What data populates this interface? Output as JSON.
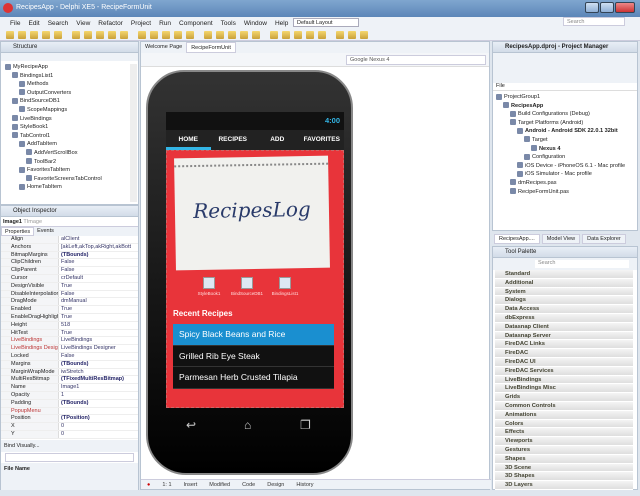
{
  "window": {
    "title": "RecipesApp - Delphi XE5 - RecipeFormUnit"
  },
  "menu": [
    "File",
    "Edit",
    "Search",
    "View",
    "Refactor",
    "Project",
    "Run",
    "Component",
    "Tools",
    "Window",
    "Help"
  ],
  "layout_combo": "Default Layout",
  "search_placeholder": "Search",
  "structure": {
    "title": "Structure",
    "items": [
      {
        "label": "MyRecipeApp",
        "level": 0
      },
      {
        "label": "BindingsList1",
        "level": 1
      },
      {
        "label": "Methods",
        "level": 2
      },
      {
        "label": "OutputConverters",
        "level": 2
      },
      {
        "label": "BindSourceDB1",
        "level": 1
      },
      {
        "label": "ScopeMappings",
        "level": 2
      },
      {
        "label": "LiveBindings",
        "level": 1
      },
      {
        "label": "StyleBook1",
        "level": 1
      },
      {
        "label": "TabControl1",
        "level": 1
      },
      {
        "label": "AddTabItem",
        "level": 2
      },
      {
        "label": "AddVertScrollBox",
        "level": 3
      },
      {
        "label": "ToolBar2",
        "level": 3
      },
      {
        "label": "FavoritesTabItem",
        "level": 2
      },
      {
        "label": "FavoriteScreensTabControl",
        "level": 3
      },
      {
        "label": "HomeTabItem",
        "level": 2
      }
    ]
  },
  "object_inspector": {
    "title": "Object Inspector",
    "selected": "Image1",
    "selected_type": "TImage",
    "tabs": [
      "Properties",
      "Events"
    ],
    "rows": [
      [
        "Align",
        "alClient"
      ],
      [
        "Anchors",
        "[akLeft,akTop,akRight,akBott"
      ],
      [
        "BitmapMargins",
        "(TBounds)"
      ],
      [
        "ClipChildren",
        "False"
      ],
      [
        "ClipParent",
        "False"
      ],
      [
        "Cursor",
        "crDefault"
      ],
      [
        "DesignVisible",
        "True"
      ],
      [
        "DisableInterpolation",
        "False"
      ],
      [
        "DragMode",
        "dmManual"
      ],
      [
        "Enabled",
        "True"
      ],
      [
        "EnableDragHighlight",
        "True"
      ],
      [
        "Height",
        "518"
      ],
      [
        "HitTest",
        "True"
      ],
      [
        "LiveBindings",
        "LiveBindings"
      ],
      [
        "LiveBindings Designer",
        "LiveBindings Designer"
      ],
      [
        "Locked",
        "False"
      ],
      [
        "Margins",
        "(TBounds)"
      ],
      [
        "MarginWrapMode",
        "iwStretch"
      ],
      [
        "MultiResBitmap",
        "(TFixedMultiResBitmap)"
      ],
      [
        "Name",
        "Image1"
      ],
      [
        "Opacity",
        "1"
      ],
      [
        "Padding",
        "(TBounds)"
      ],
      [
        "PopupMenu",
        ""
      ],
      [
        "Position",
        "(TPosition)"
      ],
      [
        "X",
        "0"
      ],
      [
        "Y",
        "0"
      ]
    ],
    "bind_visually": "Bind Visually...",
    "file_name_label": "File Name"
  },
  "editor": {
    "tabs": [
      "Welcome Page",
      "RecipeFormUnit"
    ],
    "device": "Google Nexus 4"
  },
  "phone": {
    "time": "4:00",
    "tabs": [
      "HOME",
      "RECIPES",
      "ADD",
      "FAVORITES"
    ],
    "logo_text": "RecipesLog",
    "components": [
      "StyleBook1",
      "BindSourceDB1",
      "BindingsList1"
    ],
    "recent_title": "Recent Recipes",
    "recipes": [
      "Spicy Black Beans and Rice",
      "Grilled Rib Eye Steak",
      "Parmesan Herb Crusted Tilapia"
    ],
    "accent": "#1a8fd0",
    "background": "#e8343a"
  },
  "status_bar": {
    "position": "1: 1",
    "mode": "Insert",
    "state": "Modified",
    "tabs": [
      "Code",
      "Design",
      "History"
    ]
  },
  "project_manager": {
    "title": "RecipesApp.dproj - Project Manager",
    "column": "File",
    "items": [
      {
        "label": "ProjectGroup1",
        "level": 0
      },
      {
        "label": "RecipesApp",
        "level": 1,
        "bold": true
      },
      {
        "label": "Build Configurations (Debug)",
        "level": 2
      },
      {
        "label": "Target Platforms (Android)",
        "level": 2
      },
      {
        "label": "Android - Android SDK 22.0.1 32bit",
        "level": 3,
        "bold": true
      },
      {
        "label": "Target",
        "level": 4
      },
      {
        "label": "Nexus 4",
        "level": 5,
        "bold": true
      },
      {
        "label": "Configuration",
        "level": 4
      },
      {
        "label": "iOS Device - iPhoneOS 6.1 - Mac profile",
        "level": 3
      },
      {
        "label": "iOS Simulator - Mac profile",
        "level": 3
      },
      {
        "label": "dmRecipes.pas",
        "level": 2
      },
      {
        "label": "RecipeFormUnit.pas",
        "level": 2
      }
    ]
  },
  "right_tabs": [
    "RecipesApp....",
    "Model View",
    "Data Explorer"
  ],
  "tool_palette": {
    "title": "Tool Palette",
    "search_placeholder": "Search",
    "categories": [
      "Standard",
      "Additional",
      "System",
      "Dialogs",
      "Data Access",
      "dbExpress",
      "Datasnap Client",
      "Datasnap Server",
      "FireDAC Links",
      "FireDAC",
      "FireDAC UI",
      "FireDAC Services",
      "LiveBindings",
      "LiveBindings Misc",
      "Grids",
      "Common Controls",
      "Animations",
      "Colors",
      "Effects",
      "Viewports",
      "Gestures",
      "Shapes",
      "3D Scene",
      "3D Shapes",
      "3D Layers"
    ]
  }
}
